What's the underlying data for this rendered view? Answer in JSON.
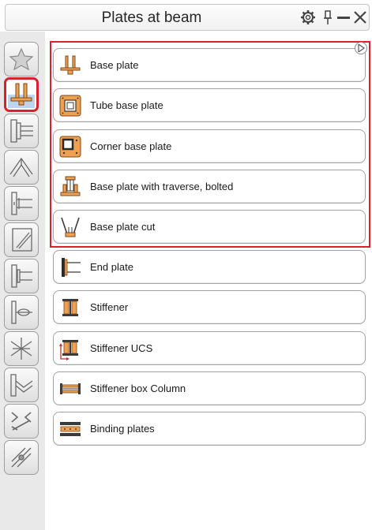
{
  "window": {
    "title": "Plates at beam",
    "controls": [
      "gear-icon",
      "pin-icon",
      "minimize-icon",
      "close-icon"
    ]
  },
  "categories": [
    {
      "name": "favorites-icon",
      "selected": false
    },
    {
      "name": "base-plates-icon",
      "selected": true
    },
    {
      "name": "beam-connection-icon",
      "selected": false
    },
    {
      "name": "frame-corner-icon",
      "selected": false
    },
    {
      "name": "beam-to-column-icon",
      "selected": false
    },
    {
      "name": "bracing-icon",
      "selected": false
    },
    {
      "name": "column-end-plate-icon",
      "selected": false
    },
    {
      "name": "pipe-connection-icon",
      "selected": false
    },
    {
      "name": "truss-icon",
      "selected": false
    },
    {
      "name": "ridge-icon",
      "selected": false
    },
    {
      "name": "cross-bracing-icon",
      "selected": false
    },
    {
      "name": "tools-icon",
      "selected": false
    }
  ],
  "items": [
    {
      "label": "Base plate",
      "icon": "base-plate-icon"
    },
    {
      "label": "Tube base plate",
      "icon": "tube-base-plate-icon"
    },
    {
      "label": "Corner base plate",
      "icon": "corner-base-plate-icon"
    },
    {
      "label": "Base plate with traverse, bolted",
      "icon": "traverse-base-plate-icon"
    },
    {
      "label": "Base plate cut",
      "icon": "base-plate-cut-icon"
    },
    {
      "label": "End plate",
      "icon": "end-plate-icon"
    },
    {
      "label": "Stiffener",
      "icon": "stiffener-icon"
    },
    {
      "label": "Stiffener UCS",
      "icon": "stiffener-ucs-icon"
    },
    {
      "label": "Stiffener box Column",
      "icon": "stiffener-box-column-icon"
    },
    {
      "label": "Binding plates",
      "icon": "binding-plates-icon"
    }
  ],
  "colors": {
    "accent_orange": "#f0a050",
    "highlight_red": "#d9202c",
    "icon_dark": "#3a3a3a"
  }
}
